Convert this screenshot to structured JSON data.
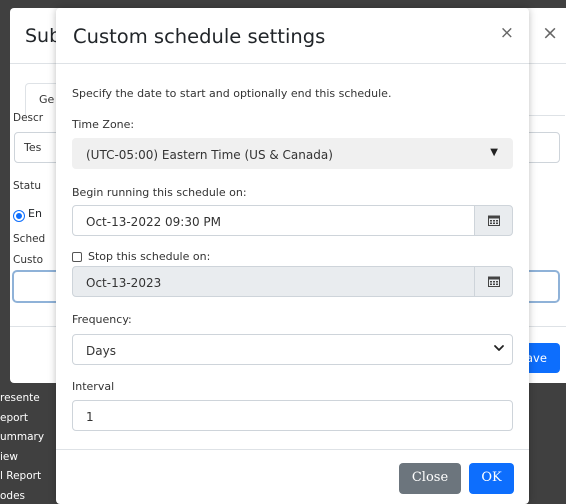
{
  "background": {
    "title": "Sub",
    "close_glyph": "×",
    "tab_label": "Ge",
    "desc_label": "Descr",
    "desc_value": "Tes",
    "status_label": "Statu",
    "radio_label": "En",
    "sched_label": "Sched",
    "custom_label": "Custo",
    "save_label": "ave",
    "side_items": [
      "resente",
      "eport",
      "ummary",
      "iew",
      "l Report",
      "odes"
    ]
  },
  "modal": {
    "title": "Custom schedule settings",
    "close_glyph": "×",
    "intro": "Specify the date to start and optionally end this schedule.",
    "timezone_label": "Time Zone:",
    "timezone_value": "(UTC-05:00) Eastern Time (US & Canada)",
    "begin_label": "Begin running this schedule on:",
    "begin_value": "Oct-13-2022 09:30 PM",
    "stop_label": "Stop this schedule on:",
    "stop_value": "Oct-13-2023",
    "stop_checked": false,
    "frequency_label": "Frequency:",
    "frequency_value": "Days",
    "interval_label": "Interval",
    "interval_value": "1",
    "close_button": "Close",
    "ok_button": "OK"
  },
  "icons": {
    "calendar": "calendar-icon",
    "caret": "caret-down-icon",
    "chevron": "chevron-down-icon",
    "close": "close-icon"
  },
  "colors": {
    "primary": "#0d6efd",
    "secondary": "#6c757d",
    "backdrop": "#404040"
  }
}
